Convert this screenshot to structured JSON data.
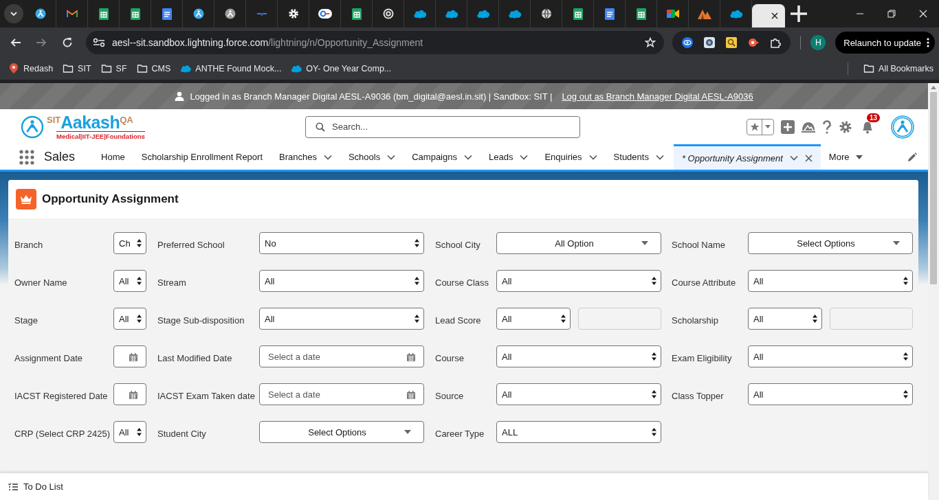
{
  "browser": {
    "tabs": [
      {
        "kind": "aakash",
        "selected": false
      },
      {
        "kind": "mail",
        "selected": false
      },
      {
        "kind": "sheet",
        "selected": false
      },
      {
        "kind": "sheet",
        "selected": false
      },
      {
        "kind": "doc",
        "selected": false
      },
      {
        "kind": "aakash",
        "selected": false
      },
      {
        "kind": "aakash-grey",
        "selected": false
      },
      {
        "kind": "dash",
        "selected": false
      },
      {
        "kind": "gear",
        "selected": false
      },
      {
        "kind": "key",
        "selected": false
      },
      {
        "kind": "sheet",
        "selected": false
      },
      {
        "kind": "ring",
        "selected": false
      },
      {
        "kind": "cloud",
        "selected": false
      },
      {
        "kind": "cloud",
        "selected": false
      },
      {
        "kind": "cloud",
        "selected": false
      },
      {
        "kind": "cloud",
        "selected": false
      },
      {
        "kind": "globe",
        "selected": false
      },
      {
        "kind": "sheet",
        "selected": false
      },
      {
        "kind": "doc",
        "selected": false
      },
      {
        "kind": "sheet",
        "selected": false
      },
      {
        "kind": "camera",
        "selected": false
      },
      {
        "kind": "peaks",
        "selected": false
      },
      {
        "kind": "cloud",
        "selected": false
      },
      {
        "kind": "blank",
        "selected": true
      }
    ],
    "address_bar": {
      "host": "aesl--sit.sandbox.lightning.force.com",
      "path": "/lightning/n/Opportunity_Assignment"
    },
    "profile_initial": "H",
    "relaunch_button": "Relaunch to update",
    "bookmarks": [
      {
        "label": "Redash",
        "kind": "pin"
      },
      {
        "label": "SIT",
        "kind": "folder"
      },
      {
        "label": "SF",
        "kind": "folder"
      },
      {
        "label": "CMS",
        "kind": "folder"
      },
      {
        "label": "ANTHE Found Mock...",
        "kind": "cloud"
      },
      {
        "label": "OY- One Year Comp...",
        "kind": "cloud"
      }
    ],
    "all_bookmarks": "All Bookmarks"
  },
  "banner": {
    "text": "Logged in as Branch Manager Digital AESL-A9036 (bm_digital@aesl.in.sit) | Sandbox: SIT |",
    "link": "Log out as Branch Manager Digital AESL-A9036"
  },
  "header": {
    "logo": {
      "prefix": "SIT",
      "name": "Aakash",
      "suffix": "QA",
      "tagline": "Medical|IIT-JEE|Foundations"
    },
    "search": {
      "placeholder": "Search..."
    },
    "notifications": "13"
  },
  "nav": {
    "app_name": "Sales",
    "items": [
      {
        "label": "Home",
        "kind": "link",
        "closable": false,
        "selected": false
      },
      {
        "label": "Scholarship Enrollment Report",
        "kind": "link",
        "closable": false,
        "selected": false
      },
      {
        "label": "Branches",
        "kind": "dropdown",
        "closable": false,
        "selected": false
      },
      {
        "label": "Schools",
        "kind": "dropdown",
        "closable": false,
        "selected": false
      },
      {
        "label": "Campaigns",
        "kind": "dropdown",
        "closable": false,
        "selected": false
      },
      {
        "label": "Leads",
        "kind": "dropdown",
        "closable": false,
        "selected": false
      },
      {
        "label": "Enquiries",
        "kind": "dropdown",
        "closable": false,
        "selected": false
      },
      {
        "label": "Students",
        "kind": "dropdown",
        "closable": false,
        "selected": false
      },
      {
        "label": "* Opportunity Assignment",
        "kind": "dropdown",
        "closable": true,
        "selected": true
      },
      {
        "label": "More",
        "kind": "more",
        "closable": false,
        "selected": false
      }
    ]
  },
  "page": {
    "title": "Opportunity Assignment",
    "rows": [
      [
        {
          "label": "Branch",
          "kind": "select",
          "value": "Ch"
        },
        {
          "label": "Preferred School",
          "kind": "select",
          "value": "No"
        },
        {
          "label": "School City",
          "kind": "picklist",
          "value": "All Option"
        },
        {
          "label": "School Name",
          "kind": "picklist",
          "value": "Select Options"
        }
      ],
      [
        {
          "label": "Owner Name",
          "kind": "select",
          "value": "All"
        },
        {
          "label": "Stream",
          "kind": "select",
          "value": "All"
        },
        {
          "label": "Course Class",
          "kind": "select",
          "value": "All"
        },
        {
          "label": "Course Attribute",
          "kind": "select",
          "value": "All"
        }
      ],
      [
        {
          "label": "Stage",
          "kind": "select",
          "value": "All"
        },
        {
          "label": "Stage Sub-disposition",
          "kind": "select",
          "value": "All"
        },
        {
          "label": "Lead Score",
          "kind": "range",
          "value": "All"
        },
        {
          "label": "Scholarship",
          "kind": "range",
          "value": "All"
        }
      ],
      [
        {
          "label": "Assignment Date",
          "kind": "date"
        },
        {
          "label": "Last Modified Date",
          "kind": "date",
          "placeholder": "Select a date"
        },
        {
          "label": "Course",
          "kind": "select",
          "value": "All"
        },
        {
          "label": "Exam Eligibility",
          "kind": "select",
          "value": "All"
        }
      ],
      [
        {
          "label": "IACST Registered Date",
          "kind": "date"
        },
        {
          "label": "IACST Exam Taken date",
          "kind": "date",
          "placeholder": "Select a date"
        },
        {
          "label": "Source",
          "kind": "select",
          "value": "All"
        },
        {
          "label": "Class Topper",
          "kind": "select",
          "value": "All"
        }
      ],
      [
        {
          "label": "CRP (Select CRP 2425)",
          "kind": "select",
          "value": "All"
        },
        {
          "label": "Student City",
          "kind": "picklist",
          "value": "Select Options"
        },
        {
          "label": "Career Type",
          "kind": "select",
          "value": "ALL"
        }
      ]
    ]
  },
  "utility_bar": {
    "items": [
      {
        "label": "To Do List"
      }
    ]
  }
}
